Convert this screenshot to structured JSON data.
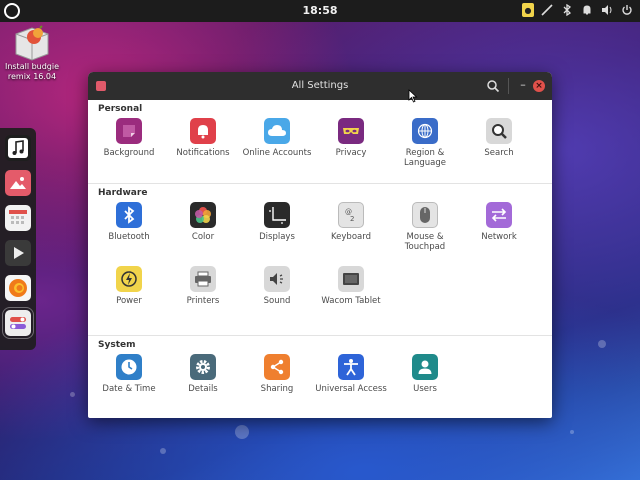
{
  "panel": {
    "clock": "18:58"
  },
  "desktop": {
    "icon_label": "Install budgie remix 16.04"
  },
  "dock": {
    "items": [
      "music-icon",
      "photos-icon",
      "calendar-icon",
      "video-icon",
      "firefox-icon",
      "settings-icon"
    ]
  },
  "window": {
    "title": "All Settings",
    "sections": [
      {
        "title": "Personal",
        "items": [
          {
            "label": "Background",
            "icon": "background-icon",
            "color": "#9b2c7e"
          },
          {
            "label": "Notifications",
            "icon": "bell-icon",
            "color": "#e0404a"
          },
          {
            "label": "Online Accounts",
            "icon": "cloud-icon",
            "color": "#4aa8e8"
          },
          {
            "label": "Privacy",
            "icon": "mask-icon",
            "color": "#7a2a80"
          },
          {
            "label": "Region & Language",
            "icon": "globe-icon",
            "color": "#3a6cc8"
          },
          {
            "label": "Search",
            "icon": "magnifier-icon",
            "color": "#d8d8d8"
          }
        ]
      },
      {
        "title": "Hardware",
        "items": [
          {
            "label": "Bluetooth",
            "icon": "bluetooth-icon",
            "color": "#2e6fd8"
          },
          {
            "label": "Color",
            "icon": "color-icon",
            "color": "#2a2a2a"
          },
          {
            "label": "Displays",
            "icon": "displays-icon",
            "color": "#2a2a2a"
          },
          {
            "label": "Keyboard",
            "icon": "keyboard-icon",
            "color": "#e4e4e4"
          },
          {
            "label": "Mouse & Touchpad",
            "icon": "mouse-icon",
            "color": "#e4e4e4"
          },
          {
            "label": "Network",
            "icon": "network-icon",
            "color": "#a36ad8"
          },
          {
            "label": "Power",
            "icon": "power-icon",
            "color": "#f1d44b"
          },
          {
            "label": "Printers",
            "icon": "printer-icon",
            "color": "#d8d8d8"
          },
          {
            "label": "Sound",
            "icon": "speaker-icon",
            "color": "#d8d8d8"
          },
          {
            "label": "Wacom Tablet",
            "icon": "tablet-icon",
            "color": "#d8d8d8"
          }
        ]
      },
      {
        "title": "System",
        "items": [
          {
            "label": "Date & Time",
            "icon": "clock-icon",
            "color": "#2f7fc8"
          },
          {
            "label": "Details",
            "icon": "gear-icon",
            "color": "#4a6a7a"
          },
          {
            "label": "Sharing",
            "icon": "share-icon",
            "color": "#ef7f2f"
          },
          {
            "label": "Universal Access",
            "icon": "accessibility-icon",
            "color": "#2e64d8"
          },
          {
            "label": "Users",
            "icon": "users-icon",
            "color": "#1f8a8a"
          }
        ]
      }
    ]
  }
}
